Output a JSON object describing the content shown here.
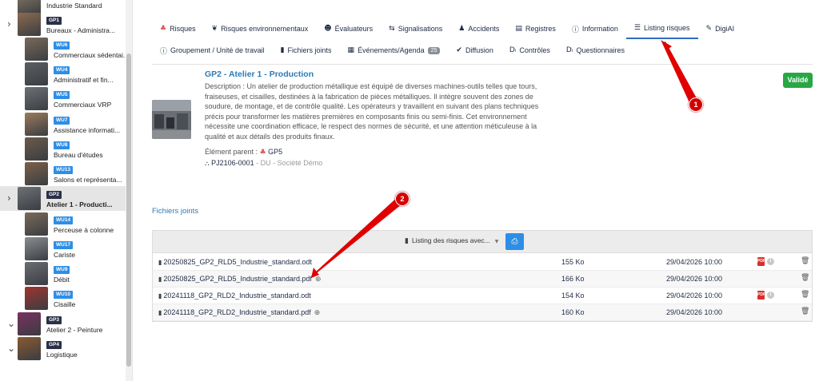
{
  "sidebar": {
    "items": [
      {
        "label": "Industrie Standard",
        "badge": "",
        "type": "root",
        "chevron": "",
        "active": false
      },
      {
        "label": "Bureaux - Administra...",
        "badge": "GP1",
        "type": "gp",
        "chevron": "›",
        "active": false
      },
      {
        "label": "Commerciaux sédentai...",
        "badge": "WU6",
        "type": "wu",
        "chevron": "",
        "active": false
      },
      {
        "label": "Administratif et fin...",
        "badge": "WU4",
        "type": "wu",
        "chevron": "",
        "active": false
      },
      {
        "label": "Commerciaux VRP",
        "badge": "WU5",
        "type": "wu",
        "chevron": "",
        "active": false
      },
      {
        "label": "Assistance informati...",
        "badge": "WU7",
        "type": "wu",
        "chevron": "",
        "active": false
      },
      {
        "label": "Bureau d'études",
        "badge": "WU8",
        "type": "wu",
        "chevron": "",
        "active": false
      },
      {
        "label": "Salons et représenta...",
        "badge": "WU13",
        "type": "wu",
        "chevron": "",
        "active": false
      },
      {
        "label": "Atelier 1 - Producti...",
        "badge": "GP2",
        "type": "gp",
        "chevron": "›",
        "active": true
      },
      {
        "label": "Perceuse à colonne",
        "badge": "WU14",
        "type": "wu",
        "chevron": "",
        "active": false
      },
      {
        "label": "Cariste",
        "badge": "WU17",
        "type": "wu",
        "chevron": "",
        "active": false
      },
      {
        "label": "Débit",
        "badge": "WU9",
        "type": "wu",
        "chevron": "",
        "active": false
      },
      {
        "label": "Cisaille",
        "badge": "WU10",
        "type": "wu",
        "chevron": "",
        "active": false
      },
      {
        "label": "Atelier 2 - Peinture",
        "badge": "GP3",
        "type": "gp",
        "chevron": "⌄",
        "active": false
      },
      {
        "label": "Logistique",
        "badge": "GP4",
        "type": "gp",
        "chevron": "⌄",
        "active": false
      }
    ]
  },
  "tabs": {
    "row1": [
      {
        "label": "Risques",
        "icon": "sitemap-icon",
        "glyph": "♣",
        "color": "#d9534f",
        "active": false
      },
      {
        "label": "Risques environnementaux",
        "icon": "leaf-icon",
        "glyph": "❦",
        "color": "#1f2a44",
        "active": false
      },
      {
        "label": "Évaluateurs",
        "icon": "user-cog-icon",
        "glyph": "☻",
        "color": "#1f2a44",
        "active": false
      },
      {
        "label": "Signalisations",
        "icon": "signs-icon",
        "glyph": "⇆",
        "color": "#1f2a44",
        "active": false
      },
      {
        "label": "Accidents",
        "icon": "injured-user-icon",
        "glyph": "♟",
        "color": "#1f2a44",
        "active": false
      },
      {
        "label": "Registres",
        "icon": "ledger-icon",
        "glyph": "▤",
        "color": "#1f2a44",
        "active": false
      },
      {
        "label": "Information",
        "icon": "info-icon",
        "glyph": "ⓘ",
        "color": "#1f2a44",
        "active": false
      },
      {
        "label": "Listing risques",
        "icon": "list-icon",
        "glyph": "☰",
        "color": "#1f2a44",
        "active": true
      },
      {
        "label": "DigiAI",
        "icon": "magic-wand-icon",
        "glyph": "✎",
        "color": "#1f2a44",
        "active": false
      }
    ],
    "row2": [
      {
        "label": "Groupement / Unité de travail",
        "icon": "info-circle-icon",
        "glyph": "ⓘ",
        "count": ""
      },
      {
        "label": "Fichiers joints",
        "icon": "file-icon",
        "glyph": "▮",
        "count": ""
      },
      {
        "label": "Événements/Agenda",
        "icon": "calendar-icon",
        "glyph": "▦",
        "count": "25"
      },
      {
        "label": "Diffusion",
        "icon": "check-circle-icon",
        "glyph": "✔",
        "count": ""
      },
      {
        "label": "Contrôles",
        "icon": "di-icon",
        "glyph": "Dᵢ",
        "count": ""
      },
      {
        "label": "Questionnaires",
        "icon": "di-icon",
        "glyph": "Dᵢ",
        "count": ""
      }
    ]
  },
  "element": {
    "title": "GP2 - Atelier 1 - Production",
    "description": "Description : Un atelier de production métallique est équipé de diverses machines-outils telles que tours, fraiseuses, et cisailles, destinées à la fabrication de pièces métalliques. Il intègre souvent des zones de soudure, de montage, et de contrôle qualité. Les opérateurs y travaillent en suivant des plans techniques précis pour transformer les matières premières en composants finis ou semi-finis. Cet environnement nécessite une coordination efficace, le respect des normes de sécurité, et une attention méticuleuse à la qualité et aux détails des produits finaux.",
    "parent_label": "Élément parent :",
    "parent_value": "GP5",
    "ref_code": "PJ2106-0001",
    "ref_company": "- DU - Société Démo",
    "status": "Validé"
  },
  "attachments": {
    "section_title": "Fichiers joints",
    "template_select": "Listing des risques avec...",
    "files": [
      {
        "name": "20250825_GP2_RLD5_Industrie_standard.odt",
        "size": "155 Ko",
        "date": "29/04/2026 10:00",
        "preview": false,
        "pdf": true
      },
      {
        "name": "20250825_GP2_RLD5_Industrie_standard.pdf",
        "size": "166 Ko",
        "date": "29/04/2026 10:00",
        "preview": true,
        "pdf": false
      },
      {
        "name": "20241118_GP2_RLD2_Industrie_standard.odt",
        "size": "154 Ko",
        "date": "29/04/2026 10:00",
        "preview": false,
        "pdf": true
      },
      {
        "name": "20241118_GP2_RLD2_Industrie_standard.pdf",
        "size": "160 Ko",
        "date": "29/04/2026 10:00",
        "preview": true,
        "pdf": false
      }
    ]
  },
  "annotations": {
    "one": "1",
    "two": "2"
  },
  "colors": {
    "accent": "#2e8ee6",
    "title_blue": "#2c7bb6",
    "status_green": "#28a745",
    "annotation_red": "#d40000"
  }
}
